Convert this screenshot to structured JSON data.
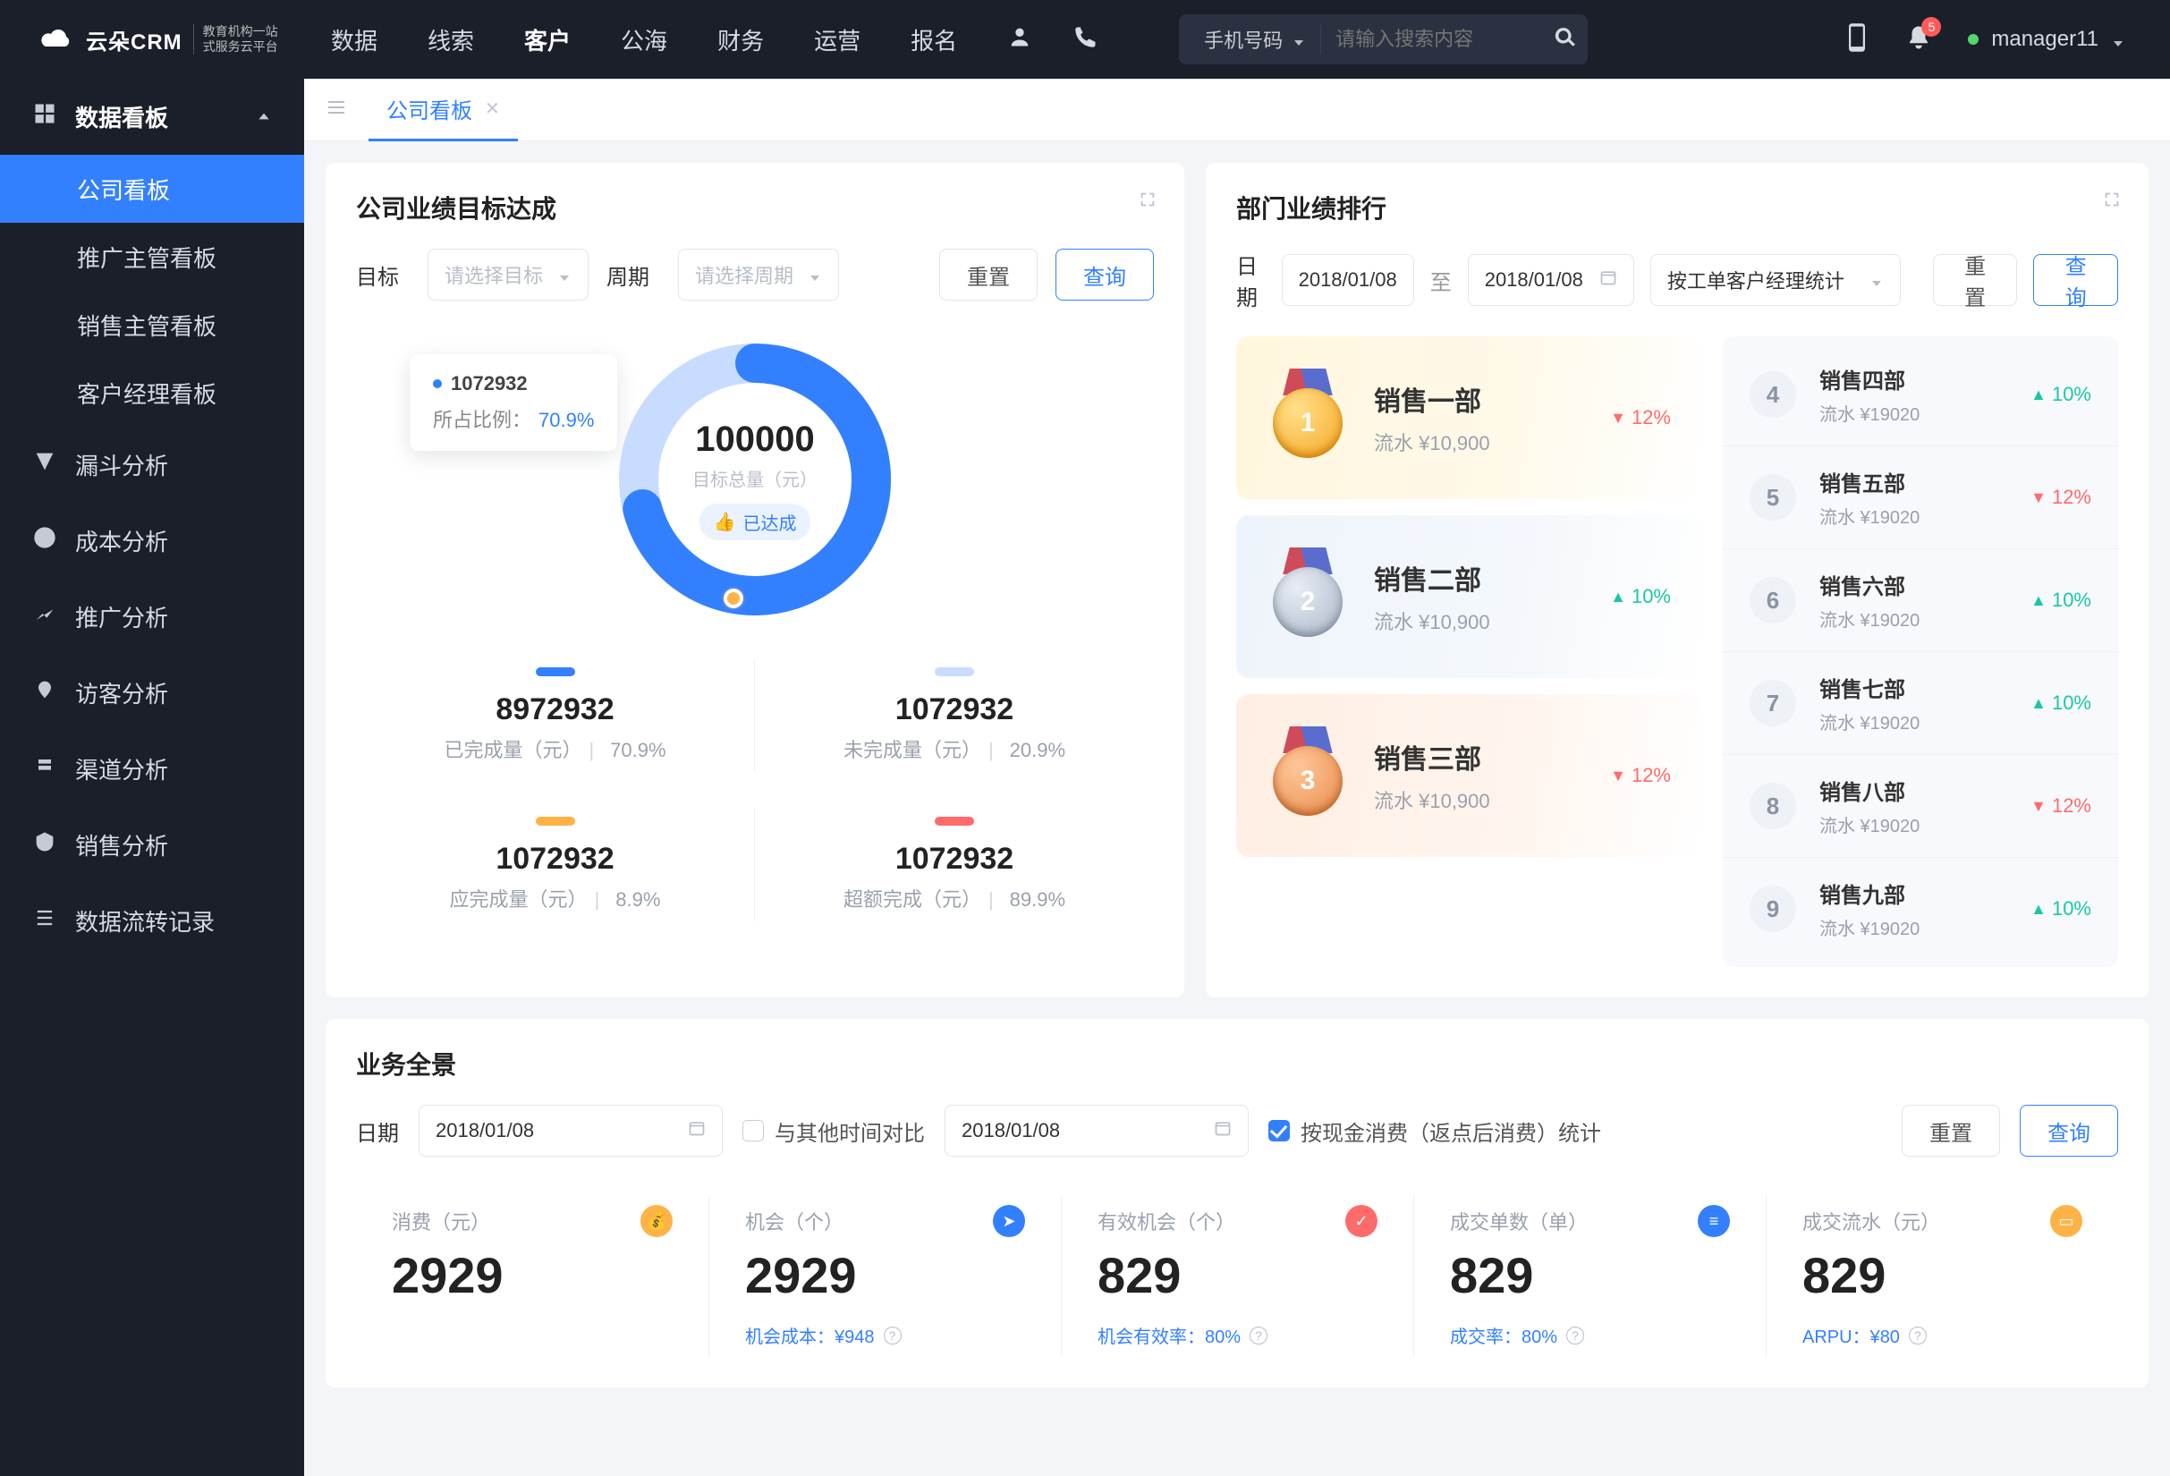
{
  "topbar": {
    "logo_text": "云朵CRM",
    "logo_sub1": "教育机构一站",
    "logo_sub2": "式服务云平台",
    "nav": [
      "数据",
      "线索",
      "客户",
      "公海",
      "财务",
      "运营",
      "报名"
    ],
    "nav_active_index": 2,
    "search_type": "手机号码",
    "search_placeholder": "请输入搜索内容",
    "badge_count": "5",
    "username": "manager11"
  },
  "sidebar": {
    "header": "数据看板",
    "subs": [
      "公司看板",
      "推广主管看板",
      "销售主管看板",
      "客户经理看板"
    ],
    "active_sub_index": 0,
    "items": [
      "漏斗分析",
      "成本分析",
      "推广分析",
      "访客分析",
      "渠道分析",
      "销售分析",
      "数据流转记录"
    ]
  },
  "tabs": {
    "items": [
      "公司看板"
    ],
    "active_index": 0
  },
  "goal_card": {
    "title": "公司业绩目标达成",
    "target_label": "目标",
    "target_placeholder": "请选择目标",
    "period_label": "周期",
    "period_placeholder": "请选择周期",
    "reset": "重置",
    "query": "查询",
    "center_value": "100000",
    "center_sub": "目标总量（元）",
    "reached": "已达成",
    "tooltip_value": "1072932",
    "tooltip_label": "所占比例：",
    "tooltip_pct": "70.9%",
    "metrics": [
      {
        "bar": "#3380ff",
        "value": "8972932",
        "label": "已完成量（元）",
        "pct": "70.9%"
      },
      {
        "bar": "#c7dcff",
        "value": "1072932",
        "label": "未完成量（元）",
        "pct": "20.9%"
      },
      {
        "bar": "#ffb347",
        "value": "1072932",
        "label": "应完成量（元）",
        "pct": "8.9%"
      },
      {
        "bar": "#ff6b6b",
        "value": "1072932",
        "label": "超额完成（元）",
        "pct": "89.9%"
      }
    ]
  },
  "rank_card": {
    "title": "部门业绩排行",
    "date_label": "日期",
    "date_from": "2018/01/08",
    "to": "至",
    "date_to": "2018/01/08",
    "stat_by": "按工单客户经理统计",
    "reset": "重置",
    "query": "查询",
    "podium": [
      {
        "rank": "1",
        "medal": "gold",
        "name": "销售一部",
        "sub": "流水 ¥10,900",
        "trend": "down",
        "pct": "12%"
      },
      {
        "rank": "2",
        "medal": "silver",
        "name": "销售二部",
        "sub": "流水 ¥10,900",
        "trend": "up",
        "pct": "10%"
      },
      {
        "rank": "3",
        "medal": "bronze",
        "name": "销售三部",
        "sub": "流水 ¥10,900",
        "trend": "down",
        "pct": "12%"
      }
    ],
    "list": [
      {
        "rank": "4",
        "name": "销售四部",
        "sub": "流水 ¥19020",
        "trend": "up",
        "pct": "10%"
      },
      {
        "rank": "5",
        "name": "销售五部",
        "sub": "流水 ¥19020",
        "trend": "down",
        "pct": "12%"
      },
      {
        "rank": "6",
        "name": "销售六部",
        "sub": "流水 ¥19020",
        "trend": "up",
        "pct": "10%"
      },
      {
        "rank": "7",
        "name": "销售七部",
        "sub": "流水 ¥19020",
        "trend": "up",
        "pct": "10%"
      },
      {
        "rank": "8",
        "name": "销售八部",
        "sub": "流水 ¥19020",
        "trend": "down",
        "pct": "12%"
      },
      {
        "rank": "9",
        "name": "销售九部",
        "sub": "流水 ¥19020",
        "trend": "up",
        "pct": "10%"
      }
    ]
  },
  "overview_card": {
    "title": "业务全景",
    "date_label": "日期",
    "date1": "2018/01/08",
    "compare_label": "与其他时间对比",
    "date2": "2018/01/08",
    "cash_stat_label": "按现金消费（返点后消费）统计",
    "reset": "重置",
    "query": "查询",
    "stats": [
      {
        "title": "消费（元）",
        "icon_bg": "#ffb347",
        "glyph": "💰",
        "value": "2929",
        "foot": ""
      },
      {
        "title": "机会（个）",
        "icon_bg": "#3380ff",
        "glyph": "➤",
        "value": "2929",
        "foot": "机会成本：¥948"
      },
      {
        "title": "有效机会（个）",
        "icon_bg": "#ff6b6b",
        "glyph": "✓",
        "value": "829",
        "foot": "机会有效率：80%"
      },
      {
        "title": "成交单数（单）",
        "icon_bg": "#3380ff",
        "glyph": "≡",
        "value": "829",
        "foot": "成交率：80%"
      },
      {
        "title": "成交流水（元）",
        "icon_bg": "#ffb347",
        "glyph": "▭",
        "value": "829",
        "foot": "ARPU：¥80"
      }
    ]
  },
  "chart_data": {
    "type": "pie",
    "title": "公司业绩目标达成",
    "total_label": "目标总量（元）",
    "total": 100000,
    "series": [
      {
        "name": "已完成量（元）",
        "value": 8972932,
        "pct": 70.9,
        "color": "#3380ff"
      },
      {
        "name": "未完成量（元）",
        "value": 1072932,
        "pct": 20.9,
        "color": "#c7dcff"
      },
      {
        "name": "应完成量（元）",
        "value": 1072932,
        "pct": 8.9,
        "color": "#ffb347"
      },
      {
        "name": "超额完成（元）",
        "value": 1072932,
        "pct": 89.9,
        "color": "#ff6b6b"
      }
    ],
    "highlight": {
      "value": 1072932,
      "pct": 70.9
    }
  }
}
